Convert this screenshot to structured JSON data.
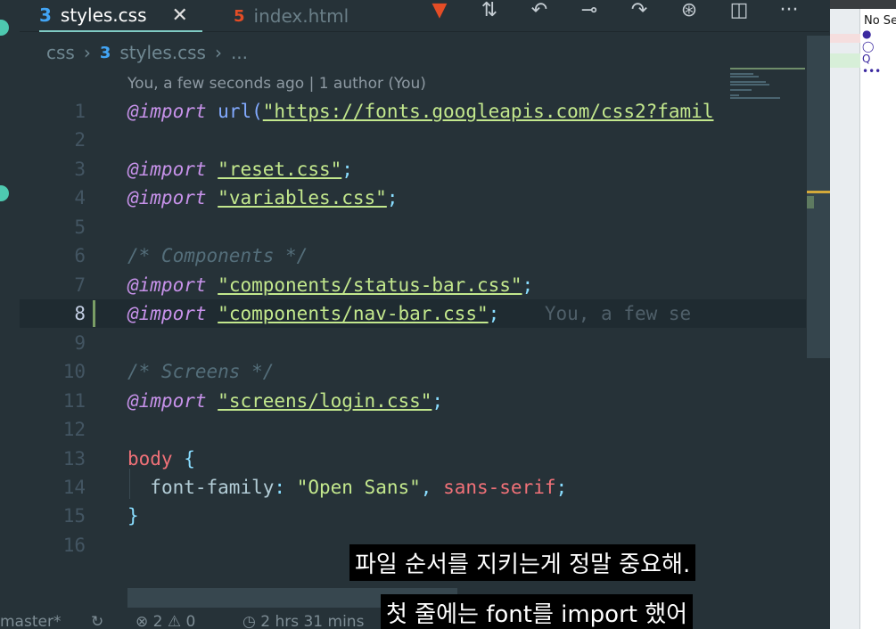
{
  "tabs": [
    {
      "icon": "css-file-icon",
      "label": "styles.css",
      "active": true
    },
    {
      "icon": "html-file-icon",
      "label": "index.html",
      "active": false
    }
  ],
  "toolbar": {
    "icons": [
      "html-preview-icon",
      "git-compare-icon",
      "go-back-icon",
      "git-commit-icon",
      "go-forward-icon",
      "git-graph-icon",
      "split-editor-icon",
      "more-actions-icon"
    ],
    "more_label": "···"
  },
  "breadcrumb": {
    "folder": "css",
    "file": "styles.css",
    "more": "..."
  },
  "blame_header": "You, a few seconds ago | 1 author (You)",
  "code": {
    "l1_kw": "@import",
    "l1_fn": "url(",
    "l1_str": "\"https://fonts.googleapis.com/css2?famil",
    "l3_kw": "@import",
    "l3_str": "\"reset.css\"",
    "l3_end": ";",
    "l4_kw": "@import",
    "l4_str": "\"variables.css\"",
    "l4_end": ";",
    "l6_cm": "/* Components */",
    "l7_kw": "@import",
    "l7_str": "\"components/status-bar.css\"",
    "l7_end": ";",
    "l8_kw": "@import",
    "l8_str": "\"components/nav-bar.css\"",
    "l8_end": ";",
    "l8_ghost": "You, a few se",
    "l10_cm": "/* Screens */",
    "l11_kw": "@import",
    "l11_str": "\"screens/login.css\"",
    "l11_end": ";",
    "l13_sel": "body",
    "l13_brace": "{",
    "l14_prop": "font-family",
    "l14_colon": ":",
    "l14_str": "\"Open Sans\"",
    "l14_comma": ",",
    "l14_val": "sans-serif",
    "l14_end": ";",
    "l15_brace": "}"
  },
  "line_numbers": [
    "1",
    "2",
    "3",
    "4",
    "5",
    "6",
    "7",
    "8",
    "9",
    "10",
    "11",
    "12",
    "13",
    "14",
    "15",
    "16"
  ],
  "right_pane": {
    "text": "No Se"
  },
  "statusbar": {
    "branch": "master*",
    "sync": "↻",
    "problems": "⊗ 2 ⚠ 0",
    "time": "◷ 2 hrs 31 mins"
  },
  "subtitles": {
    "line1": "파일 순서를 지키는게 정말 중요해.",
    "line2": "첫 줄에는 font를 import 했어"
  },
  "colors": {
    "editor_bg": "#263238",
    "keyword": "#c792ea",
    "string": "#c3e88d",
    "comment": "#546e7a",
    "selector": "#f07178",
    "punctuation": "#89ddff"
  }
}
